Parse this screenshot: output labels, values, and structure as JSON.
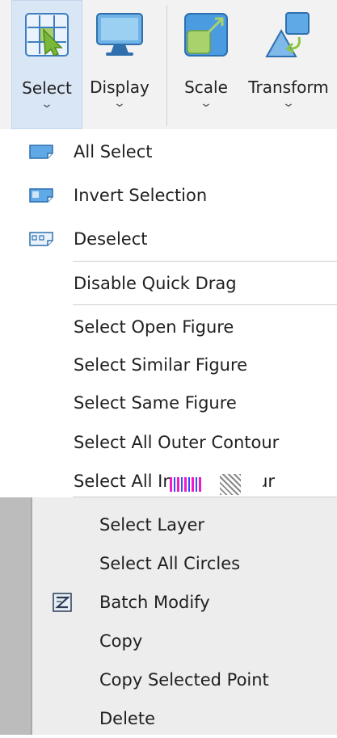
{
  "toolbar": {
    "buttons": [
      {
        "label": "Select",
        "icon": "select-grid-icon",
        "active": true
      },
      {
        "label": "Display",
        "icon": "monitor-icon"
      },
      {
        "label": "Scale",
        "icon": "scale-icon"
      },
      {
        "label": "Transform",
        "icon": "transform-icon"
      }
    ],
    "chevron": "⌄"
  },
  "menu": {
    "items": [
      {
        "label": "All Select",
        "icon": "all-select-icon"
      },
      {
        "label": "Invert Selection",
        "icon": "invert-selection-icon"
      },
      {
        "label": "Deselect",
        "icon": "deselect-icon"
      },
      {
        "label": "Disable Quick Drag"
      },
      {
        "label": "Select Open Figure"
      },
      {
        "label": "Select Similar Figure"
      },
      {
        "label": "Select Same Figure"
      },
      {
        "label": "Select All Outer Contour"
      },
      {
        "label": "Select All Inner Contour"
      }
    ],
    "visible_last_item_left": "Select All Inne",
    "visible_last_item_right": "ontour"
  },
  "submenu": {
    "items": [
      {
        "label": "Select Layer"
      },
      {
        "label": "Select All Circles"
      },
      {
        "label": "Batch Modify",
        "icon": "batch-modify-icon"
      },
      {
        "label": "Copy"
      },
      {
        "label": "Copy Selected Point"
      },
      {
        "label": "Delete"
      }
    ]
  },
  "colors": {
    "toolbar_bg": "#f2f2f2",
    "active_tab": "#d8e6f5",
    "menu_bg": "#ffffff",
    "submenu_bg": "#ededed",
    "accent_blue": "#3b84c8",
    "accent_green": "#8cc63f"
  }
}
